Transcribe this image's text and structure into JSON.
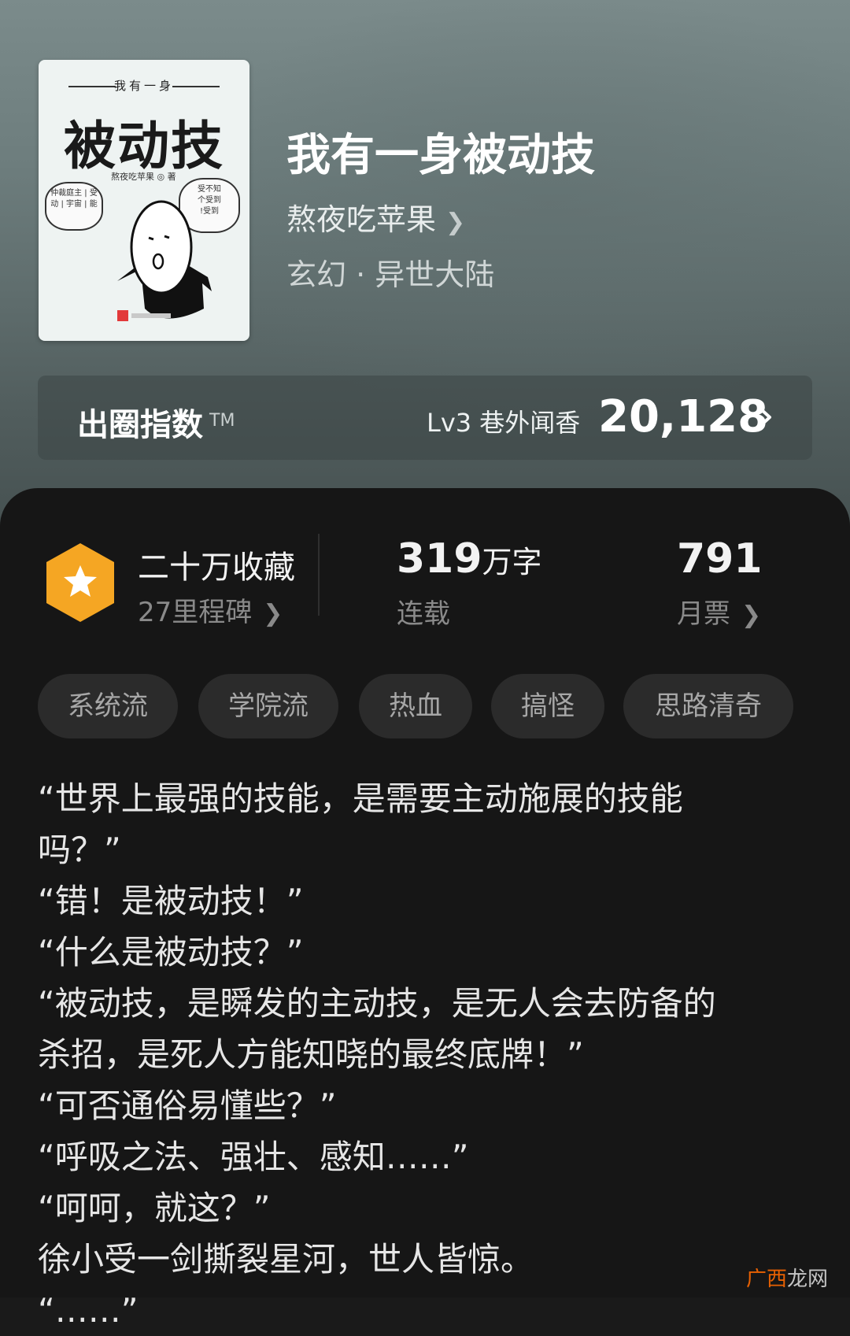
{
  "book": {
    "title": "我有一身被动技",
    "author": "熬夜吃苹果",
    "genre": "玄幻 · 异世大陆",
    "cover": {
      "subtitle": "我有一身",
      "title": "被动技",
      "author_line": "熬夜吃苹果 ◎ 著",
      "bubble_left": "仲裁庭主 | 受\n动 | 宇宙 | 能",
      "bubble_right": "受不知\n个受到\n!受到"
    }
  },
  "index": {
    "title": "出圈指数",
    "tm": "TM",
    "level": "Lv3 巷外闻香",
    "score": "20,128"
  },
  "stats": {
    "favorites": "二十万收藏",
    "milestones": "27里程碑",
    "words_num": "319",
    "words_unit": "万字",
    "status": "连载",
    "tickets": "791",
    "tickets_label": "月票"
  },
  "tags": [
    "系统流",
    "学院流",
    "热血",
    "搞怪",
    "思路清奇"
  ],
  "synopsis": [
    "“世界上最强的技能，是需要主动施展的技能",
    "吗？”",
    "“错！是被动技！”",
    "“什么是被动技？”",
    "“被动技，是瞬发的主动技，是无人会去防备的",
    "杀招，是死人方能知晓的最终底牌！”",
    "“可否通俗易懂些？”",
    "“呼吸之法、强壮、感知……”",
    "“呵呵，就这？”",
    "徐小受一剑撕裂星河，世人皆惊。",
    "“……”"
  ],
  "watermark": {
    "part1": "广西",
    "part2": "龙网"
  },
  "colors": {
    "hero_top": "#7b8b8b",
    "panel_bg": "#161616",
    "tag_bg": "#2b2b2b",
    "badge_orange": "#f5a623"
  }
}
